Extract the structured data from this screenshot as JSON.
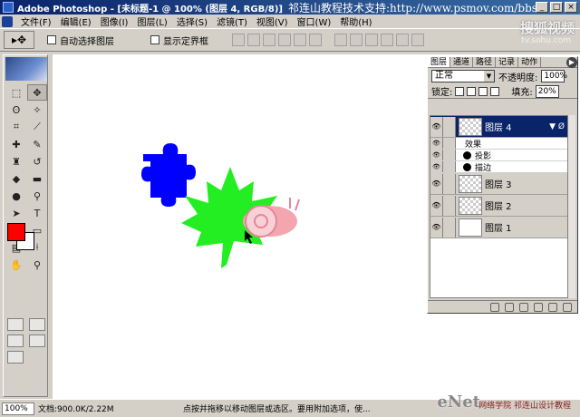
{
  "titlebar": {
    "title": "Adobe Photoshop - [未标题-1 @ 100% (图层 4, RGB/8)]",
    "tutor": "祁连山教程技术支持:http://www.psmov.com/bbs",
    "min": "_",
    "max": "□",
    "close": "×"
  },
  "menu": [
    "文件(F)",
    "编辑(E)",
    "图像(I)",
    "图层(L)",
    "选择(S)",
    "滤镜(T)",
    "视图(V)",
    "窗口(W)",
    "帮助(H)"
  ],
  "watermark": {
    "brand": "搜狐视频",
    "url": "tv.sohu.com"
  },
  "options": {
    "tool_preset": "▸✥",
    "auto_select_label": "自动选择图层",
    "show_bounds_label": "显示定界框"
  },
  "colors": {
    "foreground": "#ff0000",
    "background": "#ffffff",
    "puzzle": "#0000ff",
    "leaf": "#22ee22",
    "snail": "#f4a6b0"
  },
  "layers_panel": {
    "tabs": [
      "图层",
      "通道",
      "路径",
      "记录",
      "动作"
    ],
    "blend_mode": "正常",
    "opacity_label": "不透明度:",
    "opacity": "100%",
    "lock_label": "锁定:",
    "fill_label": "填充:",
    "fill": "20%",
    "layers": [
      {
        "name": "图层 4",
        "selected": true,
        "fx": "▼ Ø"
      },
      {
        "name": "图层 3",
        "selected": false
      },
      {
        "name": "图层 2",
        "selected": false
      },
      {
        "name": "图层 1",
        "selected": false
      }
    ],
    "effects_label": "效果",
    "effects": [
      "投影",
      "描边"
    ]
  },
  "status": {
    "zoom": "100%",
    "doc": "文档:900.0K/2.22M",
    "hint": "点按并拖移以移动图层或选区。要用附加选项，使..."
  },
  "footer_brand": {
    "net": "eNet",
    "cn": "网络学院",
    "site": "祁连山设计教程"
  }
}
